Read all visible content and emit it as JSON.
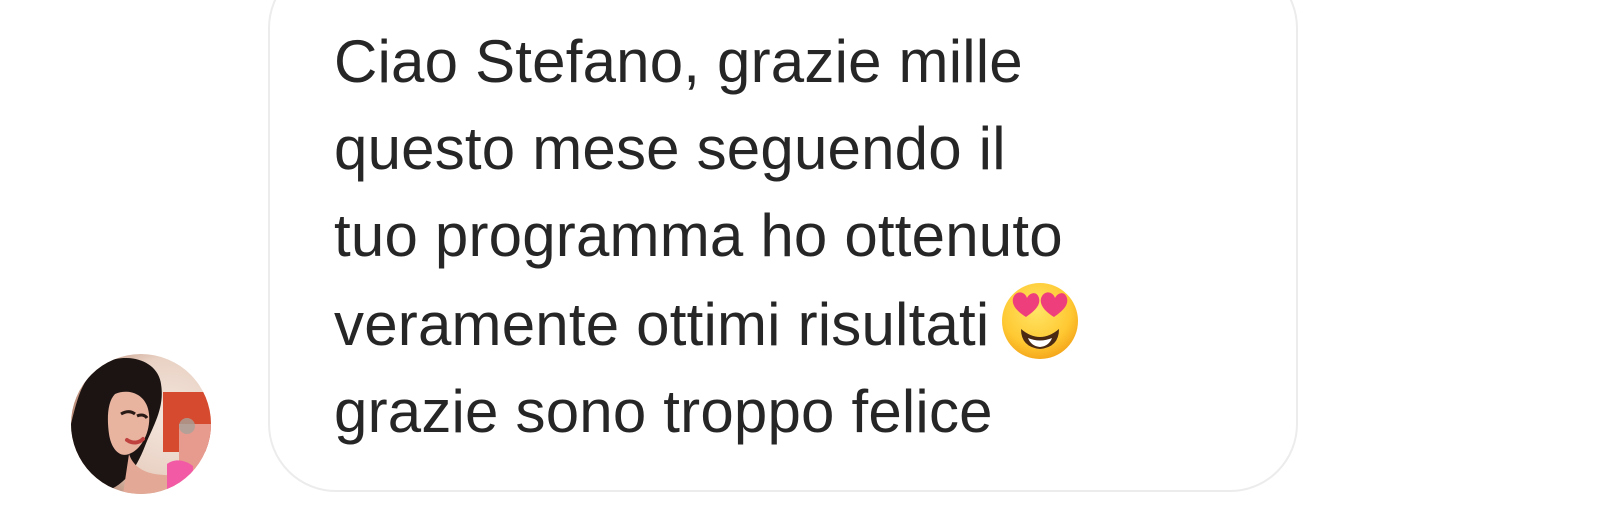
{
  "conversation": {
    "sender": {
      "avatar_icon": "user-avatar-photo"
    },
    "message": {
      "lines": [
        "Ciao Stefano, grazie mille",
        "questo mese seguendo il",
        "tuo programma ho ottenuto",
        "veramente ottimi risultati",
        "grazie sono troppo felice"
      ],
      "emoji_icon": "heart-eyes-emoji-icon",
      "text_color": "#262626",
      "bubble_border_color": "#ececec"
    }
  }
}
